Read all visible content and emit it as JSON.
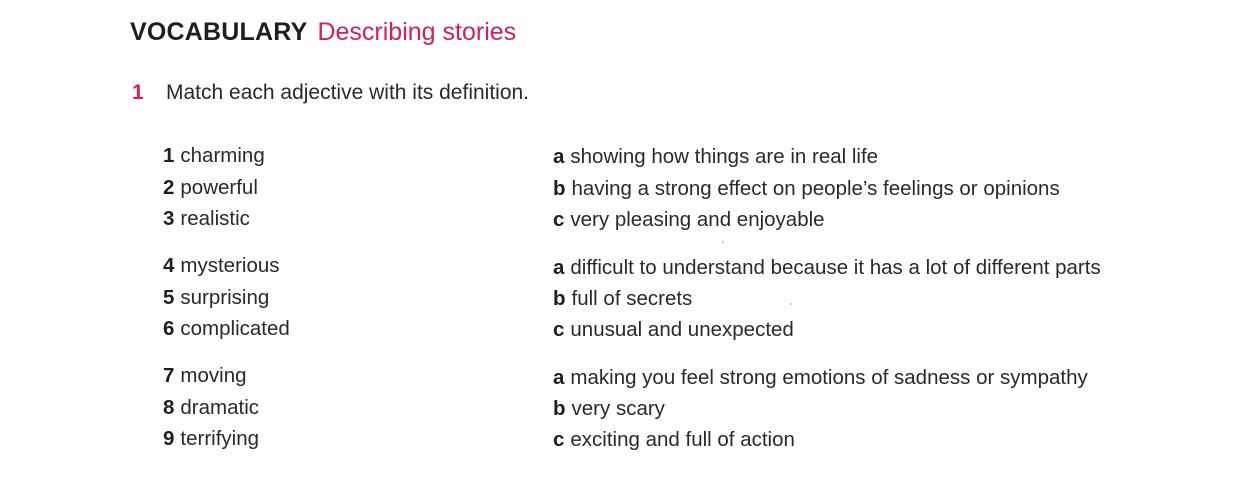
{
  "heading": {
    "keyword": "VOCABULARY",
    "subtitle": "Describing stories"
  },
  "exercise": {
    "number": "1",
    "instruction": "Match each adjective with its definition."
  },
  "groups": [
    {
      "adjectives": [
        {
          "num": "1",
          "word": "charming"
        },
        {
          "num": "2",
          "word": "powerful"
        },
        {
          "num": "3",
          "word": "realistic"
        }
      ],
      "definitions": [
        {
          "letter": "a",
          "text": "showing how things are in real life"
        },
        {
          "letter": "b",
          "text": "having a strong effect on people’s feelings or opinions"
        },
        {
          "letter": "c",
          "text": "very pleasing and enjoyable"
        }
      ]
    },
    {
      "adjectives": [
        {
          "num": "4",
          "word": "mysterious"
        },
        {
          "num": "5",
          "word": "surprising"
        },
        {
          "num": "6",
          "word": "complicated"
        }
      ],
      "definitions": [
        {
          "letter": "a",
          "text": "difficult to understand because it has a lot of different parts"
        },
        {
          "letter": "b",
          "text": "full of secrets"
        },
        {
          "letter": "c",
          "text": "unusual and unexpected"
        }
      ]
    },
    {
      "adjectives": [
        {
          "num": "7",
          "word": "moving"
        },
        {
          "num": "8",
          "word": "dramatic"
        },
        {
          "num": "9",
          "word": "terrifying"
        }
      ],
      "definitions": [
        {
          "letter": "a",
          "text": "making you feel strong emotions of sadness or sympathy"
        },
        {
          "letter": "b",
          "text": "very scary"
        },
        {
          "letter": "c",
          "text": "exciting and full of action"
        }
      ]
    }
  ]
}
